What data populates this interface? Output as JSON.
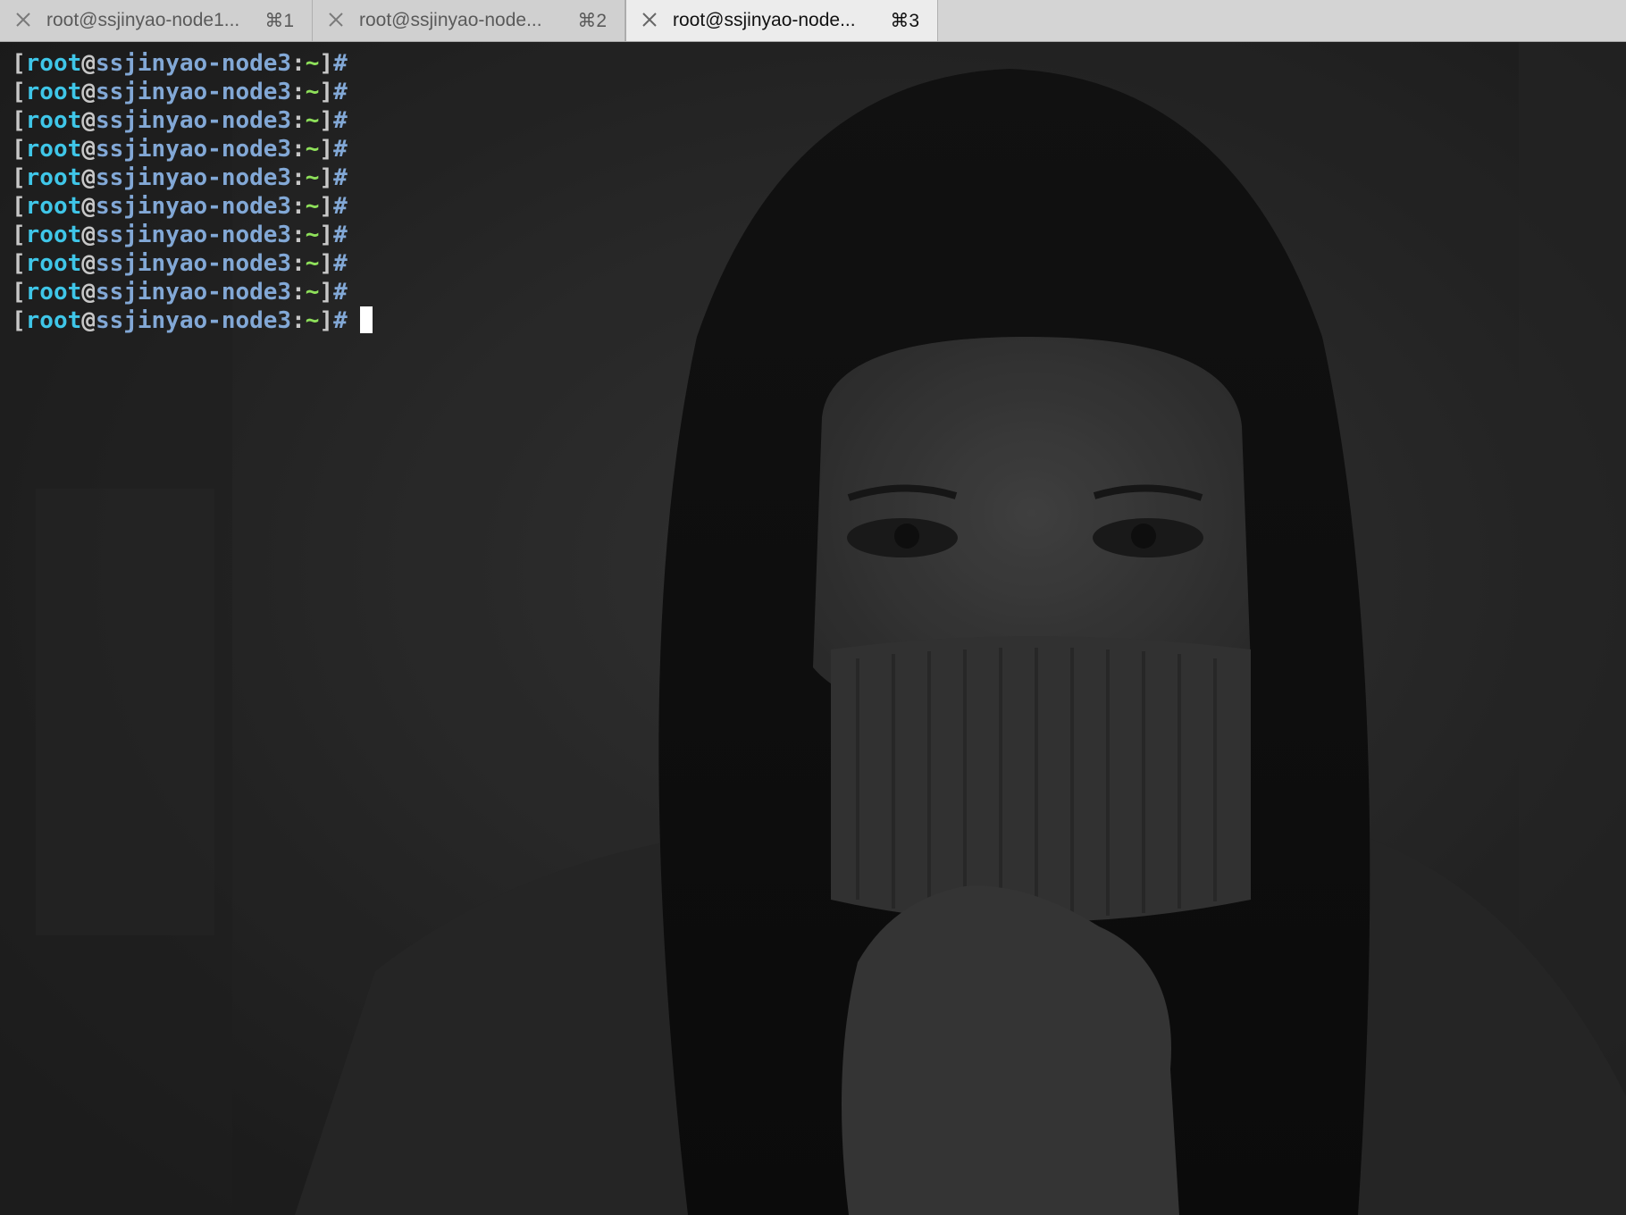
{
  "tabs": [
    {
      "title": "root@ssjinyao-node1...",
      "shortcut": "⌘1",
      "active": false
    },
    {
      "title": "root@ssjinyao-node...",
      "shortcut": "⌘2",
      "active": false
    },
    {
      "title": "root@ssjinyao-node...",
      "shortcut": "⌘3",
      "active": true
    }
  ],
  "prompt": {
    "open_bracket": "[",
    "user": "root",
    "at": "@",
    "host": "ssjinyao-node3",
    "colon": ":",
    "path": "~",
    "close_bracket": "]",
    "symbol": "#"
  },
  "prompt_line_count": 10,
  "colors": {
    "user": "#3fc6e8",
    "host": "#82a8d6",
    "path": "#8ee05a",
    "bracket": "#c8c8c8",
    "cursor": "#ffffff"
  },
  "background_image": {
    "description_icon": "portrait-photo"
  }
}
